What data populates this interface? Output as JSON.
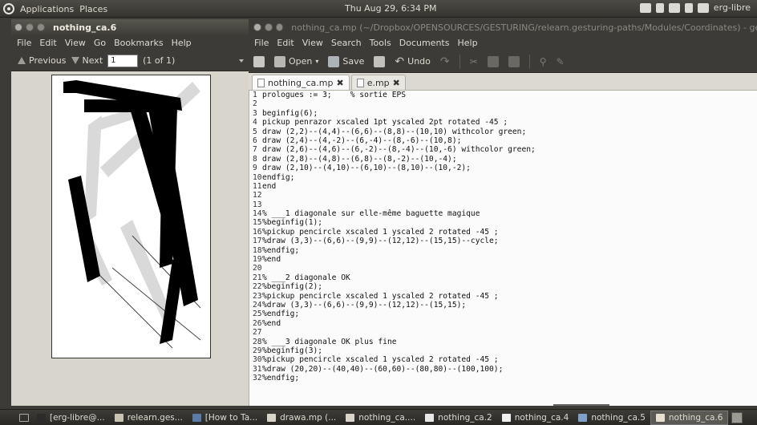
{
  "top_panel": {
    "menus": [
      "Applications",
      "Places"
    ],
    "clock": "Thu Aug 29,  6:34 PM",
    "user": "erg-libre"
  },
  "evince": {
    "title": "nothing_ca.6",
    "menu": [
      "File",
      "Edit",
      "View",
      "Go",
      "Bookmarks",
      "Help"
    ],
    "toolbar": {
      "previous": "Previous",
      "next": "Next",
      "page_value": "1",
      "page_count": "(1 of 1)"
    }
  },
  "gedit": {
    "title": "nothing_ca.mp (~/Dropbox/OPENSOURCES/GESTURING/relearn.gesturing-paths/Modules/Coordinates) - gedit",
    "menu": [
      "File",
      "Edit",
      "View",
      "Search",
      "Tools",
      "Documents",
      "Help"
    ],
    "toolbar": {
      "open": "Open",
      "save": "Save",
      "undo": "Undo"
    },
    "tabs": [
      {
        "label": "nothing_ca.mp",
        "active": true
      },
      {
        "label": "e.mp",
        "active": false
      }
    ],
    "lines": [
      {
        "n": "1",
        "t": "prologues := 3;    % sortie EPS"
      },
      {
        "n": "2",
        "t": ""
      },
      {
        "n": "3",
        "t": "beginfig(6);"
      },
      {
        "n": "4",
        "t": "pickup penrazor xscaled 1pt yscaled 2pt rotated -45 ;"
      },
      {
        "n": "5",
        "t": "draw (2,2)--(4,4)--(6,6)--(8,8)--(10,10) withcolor green;"
      },
      {
        "n": "6",
        "t": "draw (2,4)--(4,-2)--(6,-4)--(8,-6)--(10,8);"
      },
      {
        "n": "7",
        "t": "draw (2,6)--(4,6)--(6,-2)--(8,-4)--(10,-6) withcolor green;"
      },
      {
        "n": "8",
        "t": "draw (2,8)--(4,8)--(6,8)--(8,-2)--(10,-4);"
      },
      {
        "n": "9",
        "t": "draw (2,10)--(4,10)--(6,10)--(8,10)--(10,-2);"
      },
      {
        "n": "10",
        "t": "endfig;"
      },
      {
        "n": "11",
        "t": "end"
      },
      {
        "n": "12",
        "t": ""
      },
      {
        "n": "13",
        "t": ""
      },
      {
        "n": "14",
        "t": "% ___1 diagonale sur elle-même baguette magique"
      },
      {
        "n": "15",
        "t": "%beginfig(1);"
      },
      {
        "n": "16",
        "t": "%pickup pencircle xscaled 1 yscaled 2 rotated -45 ;"
      },
      {
        "n": "17",
        "t": "%draw (3,3)--(6,6)--(9,9)--(12,12)--(15,15)--cycle;"
      },
      {
        "n": "18",
        "t": "%endfig;"
      },
      {
        "n": "19",
        "t": "%end"
      },
      {
        "n": "20",
        "t": ""
      },
      {
        "n": "21",
        "t": "% ___2 diagonale OK"
      },
      {
        "n": "22",
        "t": "%beginfig(2);"
      },
      {
        "n": "23",
        "t": "%pickup pencircle xscaled 1 yscaled 2 rotated -45 ;"
      },
      {
        "n": "24",
        "t": "%draw (3,3)--(6,6)--(9,9)--(12,12)--(15,15);"
      },
      {
        "n": "25",
        "t": "%endfig;"
      },
      {
        "n": "26",
        "t": "%end"
      },
      {
        "n": "27",
        "t": ""
      },
      {
        "n": "28",
        "t": "% ___3 diagonale OK plus fine"
      },
      {
        "n": "29",
        "t": "%beginfig(3);"
      },
      {
        "n": "30",
        "t": "%pickup pencircle xscaled 1 yscaled 2 rotated -45 ;"
      },
      {
        "n": "31",
        "t": "%draw (20,20)--(40,40)--(60,60)--(80,80)--(100,100);"
      },
      {
        "n": "32",
        "t": "%endfig;"
      }
    ]
  },
  "taskbar": [
    {
      "label": "[erg-libre@...",
      "icon": "terminal-icon",
      "active": false
    },
    {
      "label": "relearn.ges...",
      "icon": "folder-icon",
      "active": false
    },
    {
      "label": "[How to Ta...",
      "icon": "browser-icon",
      "active": false
    },
    {
      "label": "drawa.mp (...",
      "icon": "gedit-icon",
      "active": false
    },
    {
      "label": "nothing_ca....",
      "icon": "gedit-icon",
      "active": false
    },
    {
      "label": "nothing_ca.2",
      "icon": "inkscape-icon",
      "active": false
    },
    {
      "label": "nothing_ca.4",
      "icon": "document-icon",
      "active": false
    },
    {
      "label": "nothing_ca.5",
      "icon": "image-icon",
      "active": false
    },
    {
      "label": "nothing_ca.6",
      "icon": "evince-icon",
      "active": true
    }
  ]
}
